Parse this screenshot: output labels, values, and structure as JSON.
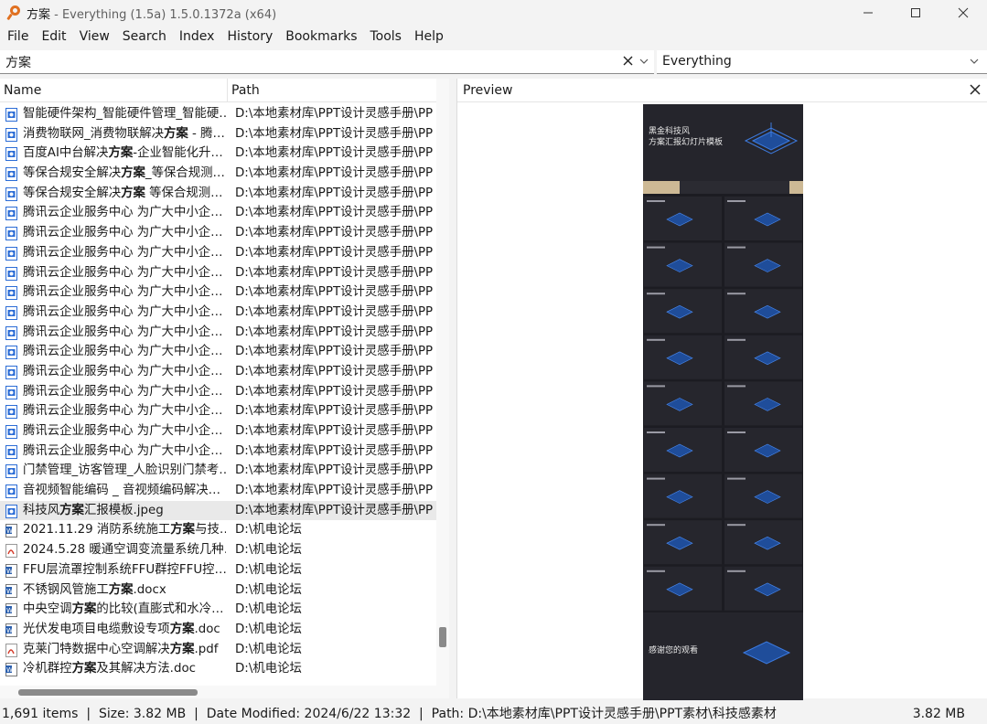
{
  "window": {
    "title_query": "方案",
    "title_rest": " - Everything (1.5a) 1.5.0.1372a (x64)"
  },
  "menu": [
    "File",
    "Edit",
    "View",
    "Search",
    "Index",
    "History",
    "Bookmarks",
    "Tools",
    "Help"
  ],
  "search": {
    "value": "方案",
    "filter": "Everything"
  },
  "columns": {
    "name": "Name",
    "path": "Path"
  },
  "rows": [
    {
      "icon": "image",
      "pre": "智能硬件架构_智能硬件管理_智能硬…",
      "bold": "",
      "post": "",
      "path": "D:\\本地素材库\\PPT设计灵感手册\\PP"
    },
    {
      "icon": "image",
      "pre": "消费物联网_消费物联解决",
      "bold": "方案",
      "post": " - 腾…",
      "path": "D:\\本地素材库\\PPT设计灵感手册\\PP"
    },
    {
      "icon": "image",
      "pre": "百度AI中台解决",
      "bold": "方案",
      "post": "-企业智能化升…",
      "path": "D:\\本地素材库\\PPT设计灵感手册\\PP"
    },
    {
      "icon": "image",
      "pre": "等保合规安全解决",
      "bold": "方案",
      "post": "_等保合规测…",
      "path": "D:\\本地素材库\\PPT设计灵感手册\\PP"
    },
    {
      "icon": "image",
      "pre": "等保合规安全解决",
      "bold": "方案",
      "post": " 等保合规测…",
      "path": "D:\\本地素材库\\PPT设计灵感手册\\PP"
    },
    {
      "icon": "image",
      "pre": "腾讯云企业服务中心 为广大中小企…",
      "bold": "",
      "post": "",
      "path": "D:\\本地素材库\\PPT设计灵感手册\\PP"
    },
    {
      "icon": "image",
      "pre": "腾讯云企业服务中心 为广大中小企…",
      "bold": "",
      "post": "",
      "path": "D:\\本地素材库\\PPT设计灵感手册\\PP"
    },
    {
      "icon": "image",
      "pre": "腾讯云企业服务中心 为广大中小企…",
      "bold": "",
      "post": "",
      "path": "D:\\本地素材库\\PPT设计灵感手册\\PP"
    },
    {
      "icon": "image",
      "pre": "腾讯云企业服务中心 为广大中小企…",
      "bold": "",
      "post": "",
      "path": "D:\\本地素材库\\PPT设计灵感手册\\PP"
    },
    {
      "icon": "image",
      "pre": "腾讯云企业服务中心 为广大中小企…",
      "bold": "",
      "post": "",
      "path": "D:\\本地素材库\\PPT设计灵感手册\\PP"
    },
    {
      "icon": "image",
      "pre": "腾讯云企业服务中心 为广大中小企…",
      "bold": "",
      "post": "",
      "path": "D:\\本地素材库\\PPT设计灵感手册\\PP"
    },
    {
      "icon": "image",
      "pre": "腾讯云企业服务中心 为广大中小企…",
      "bold": "",
      "post": "",
      "path": "D:\\本地素材库\\PPT设计灵感手册\\PP"
    },
    {
      "icon": "image",
      "pre": "腾讯云企业服务中心 为广大中小企…",
      "bold": "",
      "post": "",
      "path": "D:\\本地素材库\\PPT设计灵感手册\\PP"
    },
    {
      "icon": "image",
      "pre": "腾讯云企业服务中心 为广大中小企…",
      "bold": "",
      "post": "",
      "path": "D:\\本地素材库\\PPT设计灵感手册\\PP"
    },
    {
      "icon": "image",
      "pre": "腾讯云企业服务中心 为广大中小企…",
      "bold": "",
      "post": "",
      "path": "D:\\本地素材库\\PPT设计灵感手册\\PP"
    },
    {
      "icon": "image",
      "pre": "腾讯云企业服务中心 为广大中小企…",
      "bold": "",
      "post": "",
      "path": "D:\\本地素材库\\PPT设计灵感手册\\PP"
    },
    {
      "icon": "image",
      "pre": "腾讯云企业服务中心 为广大中小企…",
      "bold": "",
      "post": "",
      "path": "D:\\本地素材库\\PPT设计灵感手册\\PP"
    },
    {
      "icon": "image",
      "pre": "腾讯云企业服务中心 为广大中小企…",
      "bold": "",
      "post": "",
      "path": "D:\\本地素材库\\PPT设计灵感手册\\PP"
    },
    {
      "icon": "image",
      "pre": "门禁管理_访客管理_人脸识别门禁考…",
      "bold": "",
      "post": "",
      "path": "D:\\本地素材库\\PPT设计灵感手册\\PP"
    },
    {
      "icon": "image",
      "pre": "音视频智能编码 _ 音视频编码解决…",
      "bold": "",
      "post": "",
      "path": "D:\\本地素材库\\PPT设计灵感手册\\PP"
    },
    {
      "icon": "image",
      "pre": "科技风",
      "bold": "方案",
      "post": "汇报模板.jpeg",
      "path": "D:\\本地素材库\\PPT设计灵感手册\\PP",
      "selected": true
    },
    {
      "icon": "word",
      "pre": "2021.11.29 消防系统施工",
      "bold": "方案",
      "post": "与技…",
      "path": "D:\\机电论坛"
    },
    {
      "icon": "pdf",
      "pre": "2024.5.28 暖通空调变流量系统几种…",
      "bold": "",
      "post": "",
      "path": "D:\\机电论坛"
    },
    {
      "icon": "word",
      "pre": "FFU层流罩控制系统FFU群控FFU控…",
      "bold": "",
      "post": "",
      "path": "D:\\机电论坛"
    },
    {
      "icon": "word",
      "pre": "不锈钢风管施工",
      "bold": "方案",
      "post": ".docx",
      "path": "D:\\机电论坛"
    },
    {
      "icon": "word",
      "pre": "中央空调",
      "bold": "方案",
      "post": "的比较(直膨式和水冷…",
      "path": "D:\\机电论坛"
    },
    {
      "icon": "word",
      "pre": "光伏发电项目电缆敷设专项",
      "bold": "方案",
      "post": ".doc",
      "path": "D:\\机电论坛"
    },
    {
      "icon": "pdf",
      "pre": "克莱门特数据中心空调解决",
      "bold": "方案",
      "post": ".pdf",
      "path": "D:\\机电论坛"
    },
    {
      "icon": "word",
      "pre": "冷机群控",
      "bold": "方案",
      "post": "及其解决方法.doc",
      "path": "D:\\机电论坛"
    }
  ],
  "preview": {
    "title": "Preview",
    "slide_title_1": "黑金科技风",
    "slide_title_2": "方案汇报幻灯片模板",
    "end_title": "感谢您的观看"
  },
  "status": {
    "items": "1,691 items",
    "size": "Size: 3.82 MB",
    "modified": "Date Modified: 2024/6/22 13:32",
    "path": "Path: D:\\本地素材库\\PPT设计灵感手册\\PPT素材\\科技感素材",
    "right_size": "3.82 MB"
  },
  "colors": {
    "accent": "#e07020",
    "image_icon": "#2b6cd6",
    "word_icon": "#2b5fad",
    "pdf_icon": "#d43b2a"
  }
}
